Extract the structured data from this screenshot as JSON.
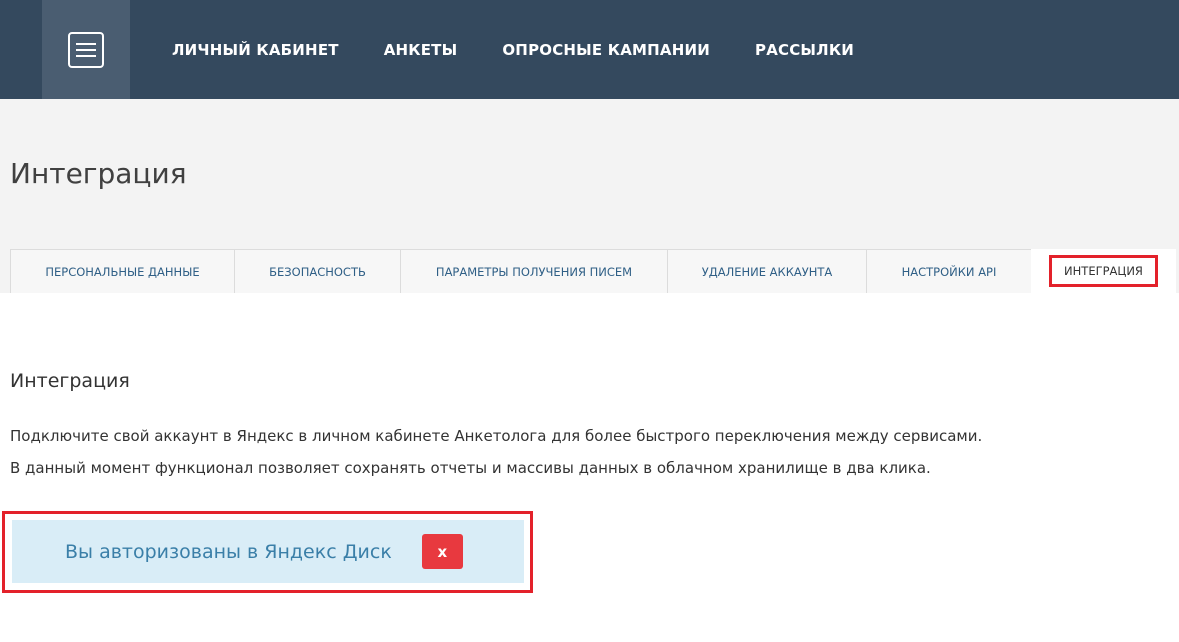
{
  "nav": {
    "items": [
      {
        "label": "ЛИЧНЫЙ КАБИНЕТ"
      },
      {
        "label": "АНКЕТЫ"
      },
      {
        "label": "ОПРОСНЫЕ КАМПАНИИ"
      },
      {
        "label": "РАССЫЛКИ"
      }
    ]
  },
  "page": {
    "title": "Интеграция"
  },
  "tabs": [
    {
      "label": "ПЕРСОНАЛЬНЫЕ ДАННЫЕ"
    },
    {
      "label": "БЕЗОПАСНОСТЬ"
    },
    {
      "label": "ПАРАМЕТРЫ ПОЛУЧЕНИЯ ПИСЕМ"
    },
    {
      "label": "УДАЛЕНИЕ АККАУНТА"
    },
    {
      "label": "НАСТРОЙКИ API"
    },
    {
      "label": "ИНТЕГРАЦИЯ",
      "active": true
    }
  ],
  "section": {
    "title": "Интеграция",
    "line1": "Подключите свой аккаунт в Яндекс в личном кабинете Анкетолога для более быстрого переключения между сервисами.",
    "line2": "В данный момент функционал позволяет сохранять отчеты и массивы данных в облачном хранилище в два клика."
  },
  "alert": {
    "text": "Вы авторизованы в Яндекс Диск",
    "close_label": "x"
  },
  "colors": {
    "header_bg": "#34495e",
    "accent_red": "#e3212a",
    "alert_bg": "#d9edf7",
    "link_blue": "#2f5f86"
  }
}
